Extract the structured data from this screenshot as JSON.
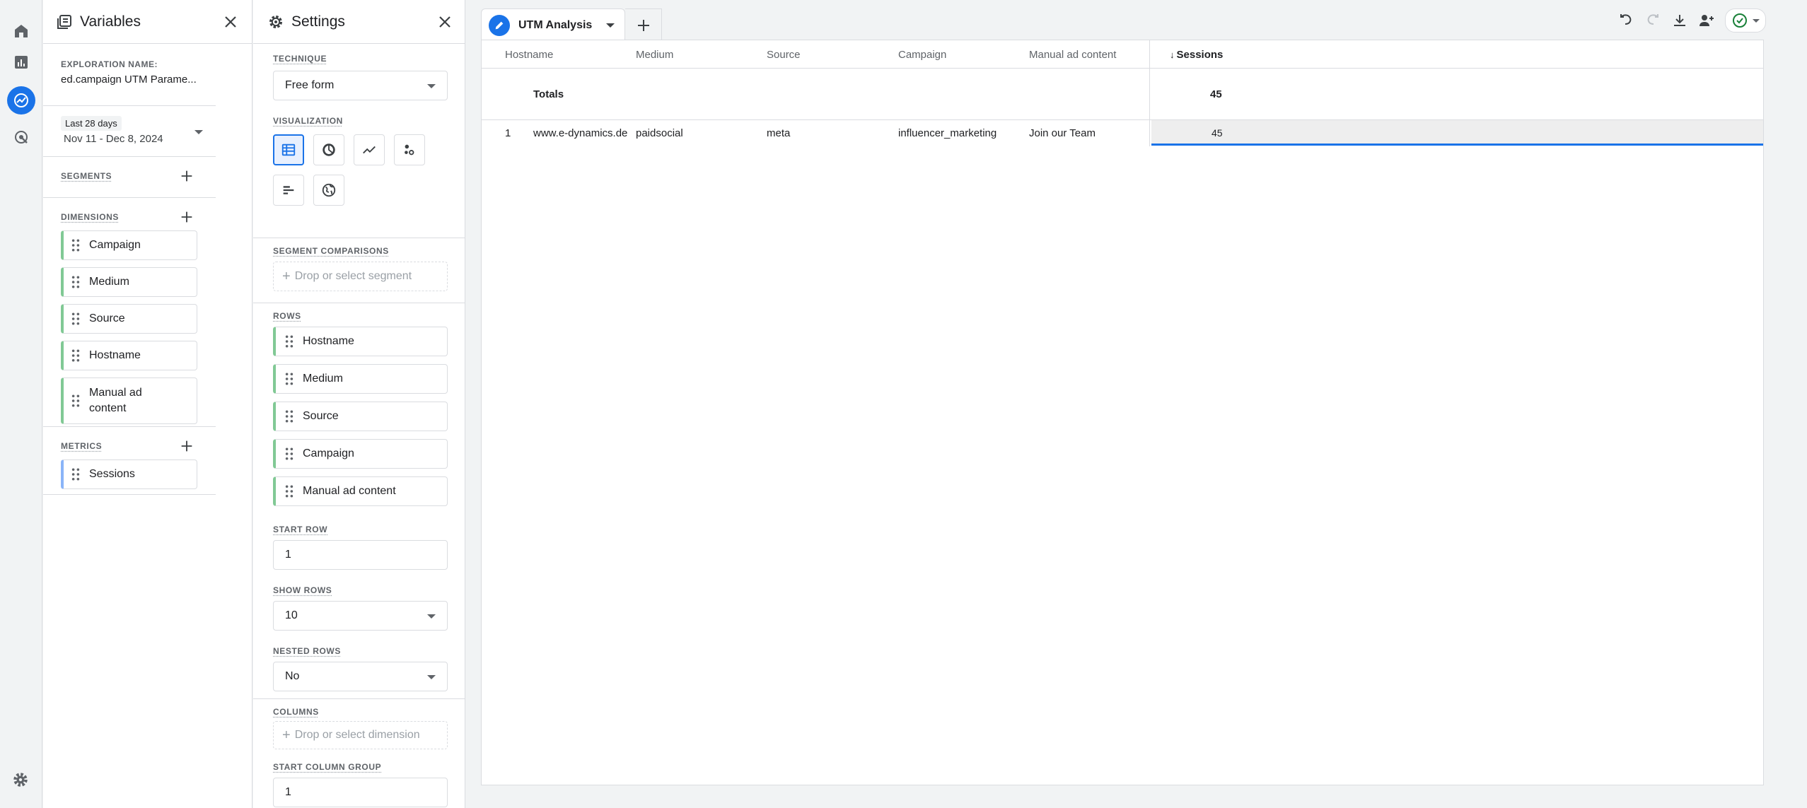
{
  "variables": {
    "title": "Variables",
    "exploration_label": "EXPLORATION NAME:",
    "exploration_name": "ed.campaign UTM Parame...",
    "date_range_label": "Last 28 days",
    "date_range": "Nov 11 - Dec 8, 2024",
    "segments_label": "SEGMENTS",
    "dimensions_label": "DIMENSIONS",
    "dimensions": [
      "Campaign",
      "Medium",
      "Source",
      "Hostname",
      "Manual ad content"
    ],
    "metrics_label": "METRICS",
    "metrics": [
      "Sessions"
    ]
  },
  "settings": {
    "title": "Settings",
    "technique_label": "TECHNIQUE",
    "technique": "Free form",
    "visualization_label": "VISUALIZATION",
    "segment_comparisons_label": "SEGMENT COMPARISONS",
    "segment_placeholder": "Drop or select segment",
    "rows_label": "ROWS",
    "rows": [
      "Hostname",
      "Medium",
      "Source",
      "Campaign",
      "Manual ad content"
    ],
    "start_row_label": "START ROW",
    "start_row": "1",
    "show_rows_label": "SHOW ROWS",
    "show_rows": "10",
    "nested_rows_label": "NESTED ROWS",
    "nested_rows": "No",
    "columns_label": "COLUMNS",
    "column_placeholder": "Drop or select dimension",
    "start_column_group_label": "START COLUMN GROUP",
    "start_column_group": "1"
  },
  "tab": {
    "label": "UTM Analysis"
  },
  "table": {
    "headers": [
      "Hostname",
      "Medium",
      "Source",
      "Campaign",
      "Manual ad content"
    ],
    "metric_header": "Sessions",
    "totals_label": "Totals",
    "totals_value": "45",
    "rows": [
      {
        "index": "1",
        "hostname": "www.e-dynamics.de",
        "medium": "paidsocial",
        "source": "meta",
        "campaign": "influencer_marketing",
        "ad_content": "Join our Team",
        "sessions": "45"
      }
    ]
  },
  "colors": {
    "accent": "#1a73e8",
    "dimension_chip": "#81c995",
    "metric_chip": "#8ab4f8"
  }
}
